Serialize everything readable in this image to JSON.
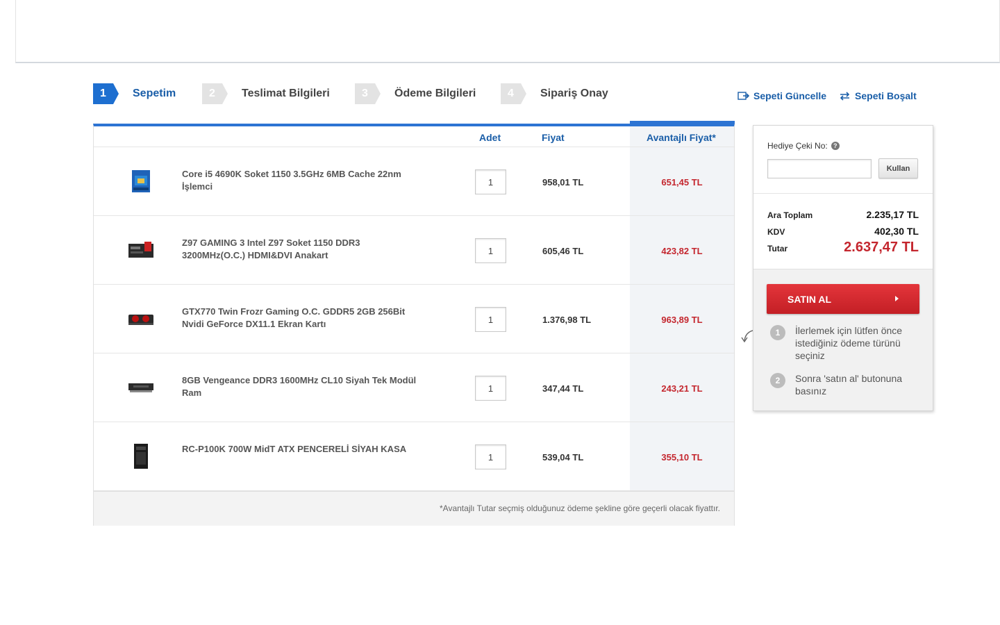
{
  "steps": [
    {
      "num": "1",
      "label": "Sepetim",
      "active": true
    },
    {
      "num": "2",
      "label": "Teslimat Bilgileri"
    },
    {
      "num": "3",
      "label": "Ödeme Bilgileri"
    },
    {
      "num": "4",
      "label": "Sipariş Onay"
    }
  ],
  "actions": {
    "update": "Sepeti Güncelle",
    "empty": "Sepeti Boşalt"
  },
  "table": {
    "headers": {
      "qty": "Adet",
      "price": "Fiyat",
      "adv_price": "Avantajlı Fiyat*"
    },
    "rows": [
      {
        "name": "Core i5 4690K Soket 1150 3.5GHz 6MB Cache 22nm İşlemci",
        "qty": "1",
        "price": "958,01 TL",
        "adv": "651,45 TL",
        "icon": "cpu-box-icon"
      },
      {
        "name": "Z97 GAMING 3 Intel Z97 Soket 1150 DDR3 3200MHz(O.C.) HDMI&DVI Anakart",
        "qty": "1",
        "price": "605,46 TL",
        "adv": "423,82 TL",
        "icon": "motherboard-icon"
      },
      {
        "name": "GTX770 Twin Frozr Gaming O.C. GDDR5 2GB 256Bit Nvidi GeForce DX11.1 Ekran Kartı",
        "qty": "1",
        "price": "1.376,98 TL",
        "adv": "963,89 TL",
        "icon": "graphics-card-icon"
      },
      {
        "name": "8GB Vengeance DDR3 1600MHz CL10 Siyah Tek Modül Ram",
        "qty": "1",
        "price": "347,44 TL",
        "adv": "243,21 TL",
        "icon": "ram-icon"
      },
      {
        "name": "RC-P100K 700W MidT ATX PENCERELİ SİYAH KASA",
        "qty": "1",
        "price": "539,04 TL",
        "adv": "355,10 TL",
        "icon": "pc-case-icon"
      }
    ],
    "footnote": "*Avantajlı Tutar seçmiş olduğunuz ödeme şekline göre geçerli olacak fiyattır."
  },
  "summary": {
    "gift_label": "Hediye Çeki No:",
    "help": "?",
    "gift_value": "",
    "use_button": "Kullan",
    "subtotal_label": "Ara Toplam",
    "subtotal": "2.235,17 TL",
    "tax_label": "KDV",
    "tax": "402,30 TL",
    "total_label": "Tutar",
    "total": "2.637,47 TL",
    "buy_button": "SATIN AL",
    "tips": [
      {
        "num": "1",
        "text": "İlerlemek için lütfen önce istediğiniz ödeme türünü seçiniz"
      },
      {
        "num": "2",
        "text": "Sonra 'satın al' butonuna basınız"
      }
    ]
  },
  "colors": {
    "accent": "#1e6fd0",
    "price_red": "#c4262e",
    "buy_red": "#d12a30"
  }
}
